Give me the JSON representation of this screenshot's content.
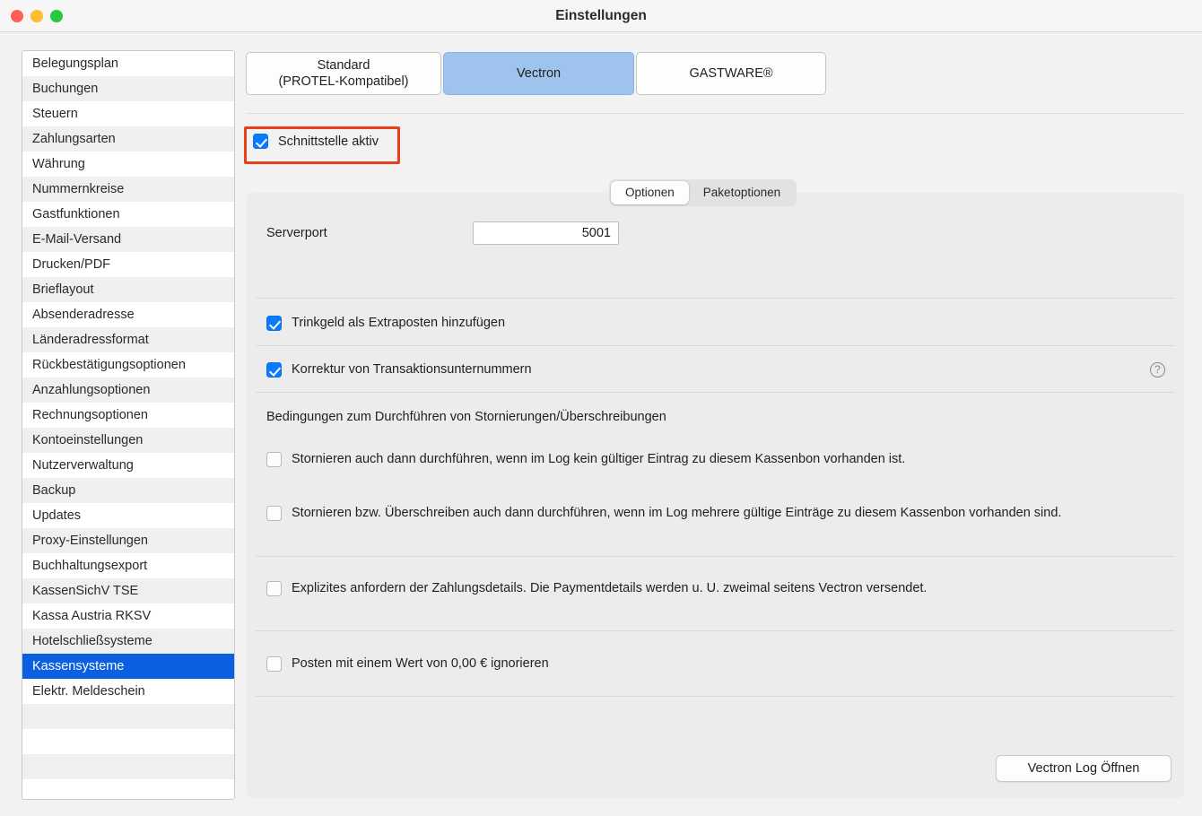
{
  "window": {
    "title": "Einstellungen",
    "traffic_lights": [
      "close-button",
      "minimize-button",
      "maximize-button"
    ]
  },
  "sidebar": {
    "items": [
      {
        "label": "Belegungsplan"
      },
      {
        "label": "Buchungen"
      },
      {
        "label": "Steuern"
      },
      {
        "label": "Zahlungsarten"
      },
      {
        "label": "Währung"
      },
      {
        "label": "Nummernkreise"
      },
      {
        "label": "Gastfunktionen"
      },
      {
        "label": "E-Mail-Versand"
      },
      {
        "label": "Drucken/PDF"
      },
      {
        "label": "Brieflayout"
      },
      {
        "label": "Absenderadresse"
      },
      {
        "label": "Länderadressformat"
      },
      {
        "label": "Rückbestätigungsoptionen"
      },
      {
        "label": "Anzahlungsoptionen"
      },
      {
        "label": "Rechnungsoptionen"
      },
      {
        "label": "Kontoeinstellungen"
      },
      {
        "label": "Nutzerverwaltung"
      },
      {
        "label": "Backup"
      },
      {
        "label": "Updates"
      },
      {
        "label": "Proxy-Einstellungen"
      },
      {
        "label": "Buchhaltungsexport"
      },
      {
        "label": "KassenSichV TSE"
      },
      {
        "label": "Kassa Austria RKSV"
      },
      {
        "label": "Hotelschließsysteme"
      },
      {
        "label": "Kassensysteme"
      },
      {
        "label": "Elektr. Meldeschein"
      }
    ],
    "selected_label": "Kassensysteme"
  },
  "top_tabs": [
    {
      "label": "Standard\n(PROTEL-Kompatibel)",
      "line1": "Standard",
      "line2": "(PROTEL-Kompatibel)",
      "active": false
    },
    {
      "label": "Vectron",
      "active": true
    },
    {
      "label": "GASTWARE®",
      "active": false
    }
  ],
  "interface": {
    "checkbox_label": "Schnittstelle aktiv",
    "checked": true,
    "annotation_color": "#E8401A"
  },
  "inner_tabs": [
    {
      "label": "Optionen",
      "active": true
    },
    {
      "label": "Paketoptionen",
      "active": false
    }
  ],
  "options": {
    "serverport_label": "Serverport",
    "serverport_value": "5001",
    "tip_checkbox": {
      "label": "Trinkgeld als Extraposten hinzufügen",
      "checked": true
    },
    "correction_checkbox": {
      "label": "Korrektur von Transaktionsunternummern",
      "checked": true,
      "help_icon": "help-circle-icon",
      "help_glyph": "?"
    },
    "section_title": "Bedingungen zum Durchführen von Stornierungen/Überschreibungen",
    "conditions": [
      {
        "label": "Stornieren auch dann durchführen, wenn im Log kein gültiger Eintrag zu diesem Kassenbon vorhanden ist.",
        "checked": false
      },
      {
        "label": "Stornieren bzw. Überschreiben auch dann durchführen, wenn im Log mehrere gültige Einträge zu diesem Kassenbon vorhanden sind.",
        "checked": false
      },
      {
        "label": "Explizites anfordern der Zahlungsdetails. Die Paymentdetails werden u. U. zweimal seitens Vectron versendet.",
        "checked": false
      },
      {
        "label": "Posten mit einem Wert von 0,00 € ignorieren",
        "checked": false
      }
    ],
    "log_button_label": "Vectron Log Öffnen"
  },
  "colors": {
    "accent_blue": "#0A7BFF",
    "selection_blue": "#0A60E0",
    "tab_active_blue": "#9EC3EC",
    "annotation_red": "#E8401A"
  }
}
